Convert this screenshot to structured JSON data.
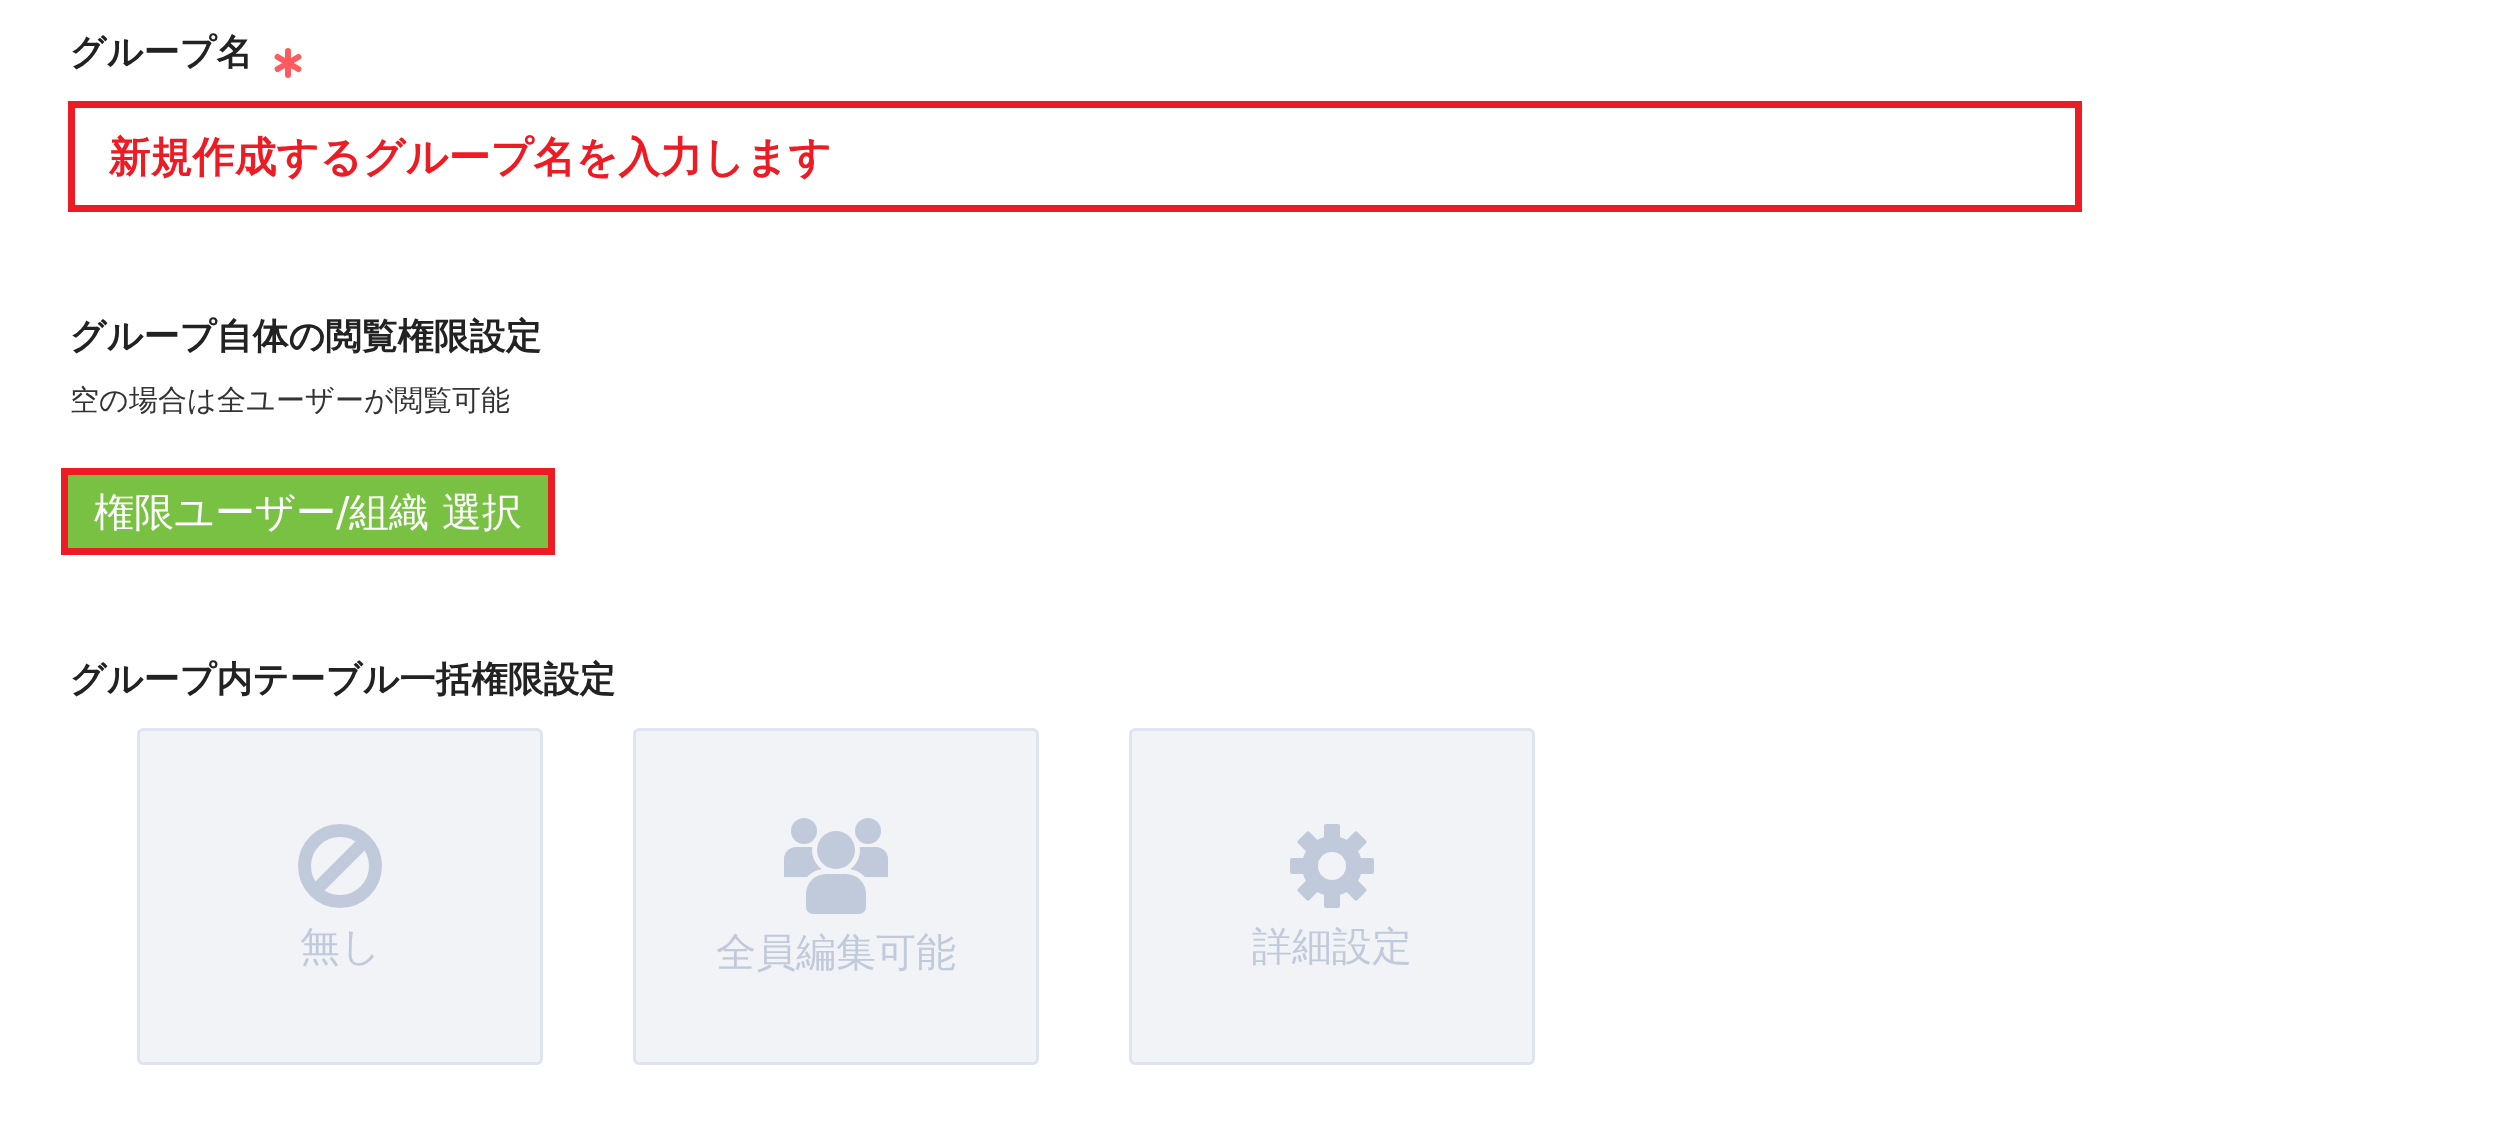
{
  "name_field": {
    "label": "グループ名",
    "required": true,
    "value": "新規作成するグループ名を入力します",
    "highlighted": true
  },
  "view_permission": {
    "heading": "グループ自体の閲覧権限設定",
    "note": "空の場合は全ユーザーが閲覧可能",
    "button": {
      "label": "権限ユーザー/組織 選択",
      "highlighted": true
    }
  },
  "table_permission": {
    "heading": "グループ内テーブル一括権限設定",
    "options": [
      {
        "kind": "none",
        "label": "無し",
        "selected": false
      },
      {
        "kind": "everyone",
        "label": "全員編集可能",
        "selected": false
      },
      {
        "kind": "custom",
        "label": "詳細設定",
        "selected": false
      }
    ]
  }
}
